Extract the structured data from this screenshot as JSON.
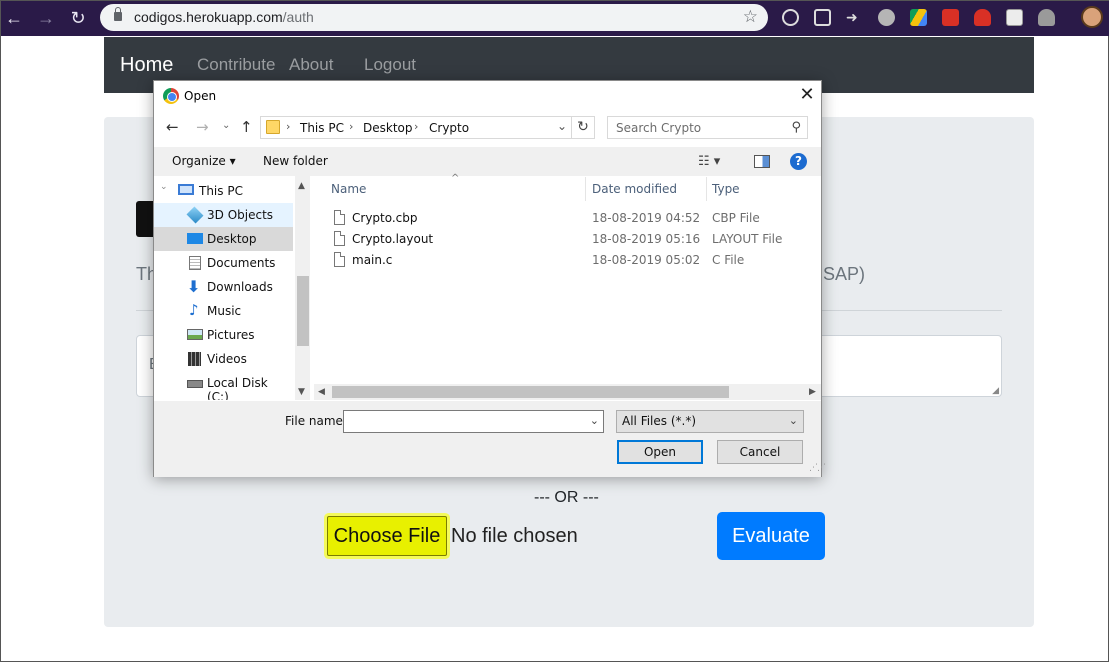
{
  "browser": {
    "url_host": "codigos.herokuapp.com",
    "url_path": "/auth"
  },
  "page": {
    "nav": {
      "brand": "Home",
      "links": [
        "Contribute",
        "About",
        "Logout"
      ]
    },
    "partial_left_text": "Th",
    "partial_right_text": "SAP)",
    "partial_textarea_text": "E",
    "or_text": "--- OR ---",
    "choose_file_label": "Choose File",
    "no_file_text": "No file chosen",
    "evaluate_label": "Evaluate"
  },
  "dialog": {
    "title": "Open",
    "breadcrumb": [
      "This PC",
      "Desktop",
      "Crypto"
    ],
    "search_placeholder": "Search Crypto",
    "organize_label": "Organize ▾",
    "new_folder_label": "New folder",
    "help_glyph": "?",
    "nav_items": [
      {
        "label": "This PC",
        "icon": "computer-icon"
      },
      {
        "label": "3D Objects",
        "icon": "cube-icon"
      },
      {
        "label": "Desktop",
        "icon": "desktop-icon"
      },
      {
        "label": "Documents",
        "icon": "document-icon"
      },
      {
        "label": "Downloads",
        "icon": "download-icon"
      },
      {
        "label": "Music",
        "icon": "music-icon"
      },
      {
        "label": "Pictures",
        "icon": "picture-icon"
      },
      {
        "label": "Videos",
        "icon": "video-icon"
      },
      {
        "label": "Local Disk (C:)",
        "icon": "disk-icon"
      }
    ],
    "columns": [
      "Name",
      "Date modified",
      "Type"
    ],
    "files": [
      {
        "name": "Crypto.cbp",
        "date": "18-08-2019 04:52",
        "type": "CBP File"
      },
      {
        "name": "Crypto.layout",
        "date": "18-08-2019 05:16",
        "type": "LAYOUT File"
      },
      {
        "name": "main.c",
        "date": "18-08-2019 05:02",
        "type": "C File"
      }
    ],
    "file_name_label": "File name:",
    "file_name_value": "",
    "filter_value": "All Files (*.*)",
    "open_label": "Open",
    "cancel_label": "Cancel"
  }
}
